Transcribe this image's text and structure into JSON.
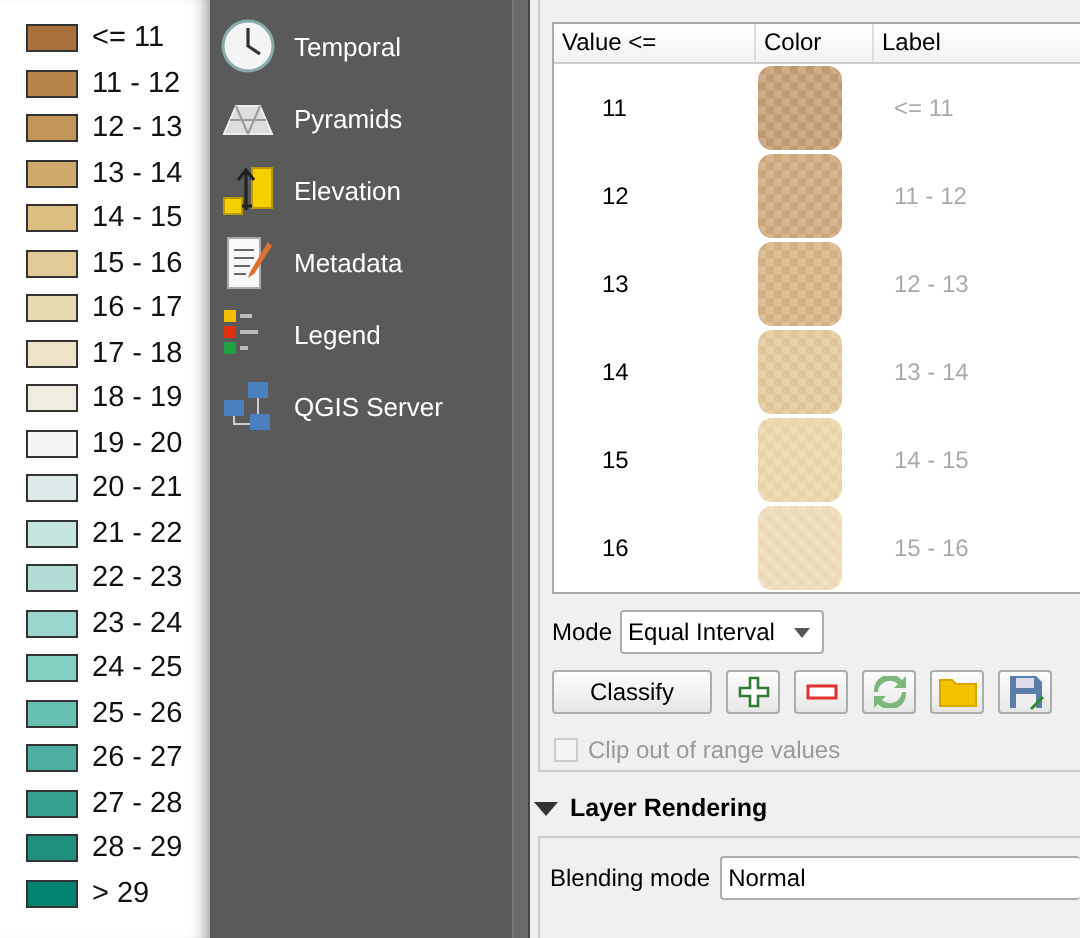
{
  "legend": {
    "items": [
      {
        "label": "<= 11",
        "color": "#a8703a"
      },
      {
        "label": "11 - 12",
        "color": "#b6834a"
      },
      {
        "label": "12 - 13",
        "color": "#c29658"
      },
      {
        "label": "13 - 14",
        "color": "#d0aa6c"
      },
      {
        "label": "14 - 15",
        "color": "#dcbe80"
      },
      {
        "label": "15 - 16",
        "color": "#e2cb96"
      },
      {
        "label": "16 - 17",
        "color": "#e8d8b0"
      },
      {
        "label": "17 - 18",
        "color": "#ede3c9"
      },
      {
        "label": "18 - 19",
        "color": "#f1ece0"
      },
      {
        "label": "19 - 20",
        "color": "#f4f4f4"
      },
      {
        "label": "20 - 21",
        "color": "#dcebea"
      },
      {
        "label": "21 - 22",
        "color": "#c7e5e0"
      },
      {
        "label": "22 - 23",
        "color": "#b1ddd6"
      },
      {
        "label": "23 - 24",
        "color": "#9ad6cb"
      },
      {
        "label": "24 - 25",
        "color": "#82cfc1"
      },
      {
        "label": "25 - 26",
        "color": "#67c1b1"
      },
      {
        "label": "26 - 27",
        "color": "#4eb0a0"
      },
      {
        "label": "27 - 28",
        "color": "#36a08e"
      },
      {
        "label": "28 - 29",
        "color": "#1e907d"
      },
      {
        "label": "> 29",
        "color": "#018571"
      }
    ]
  },
  "sidebar": {
    "items": [
      {
        "label": "Temporal",
        "kind": "clock"
      },
      {
        "label": "Pyramids",
        "kind": "pyramid"
      },
      {
        "label": "Elevation",
        "kind": "elevation"
      },
      {
        "label": "Metadata",
        "kind": "metadata"
      },
      {
        "label": "Legend",
        "kind": "legend"
      },
      {
        "label": "QGIS Server",
        "kind": "server"
      }
    ]
  },
  "table": {
    "columns": [
      "Value <=",
      "Color",
      "Label"
    ],
    "rows": [
      {
        "value": "11",
        "color": "#c29a70",
        "label": "<= 11"
      },
      {
        "value": "12",
        "color": "#cda67a",
        "label": "11 - 12"
      },
      {
        "value": "13",
        "color": "#d4b183",
        "label": "12 - 13"
      },
      {
        "value": "14",
        "color": "#e0c596",
        "label": "13 - 14"
      },
      {
        "value": "15",
        "color": "#e9d3a7",
        "label": "14 - 15"
      },
      {
        "value": "16",
        "color": "#ecdbb6",
        "label": "15 - 16"
      }
    ]
  },
  "mode": {
    "label": "Mode",
    "value": "Equal Interval"
  },
  "buttons": [
    {
      "kind": "text",
      "label": "Classify"
    },
    {
      "kind": "add"
    },
    {
      "kind": "remove"
    },
    {
      "kind": "flip"
    },
    {
      "kind": "load"
    },
    {
      "kind": "save"
    }
  ],
  "clip": {
    "label": "Clip out of range values",
    "checked": false,
    "disabled": true
  },
  "layer_rendering": {
    "title": "Layer Rendering",
    "expanded": true,
    "blending_label": "Blending mode",
    "blending_value": "Normal"
  }
}
